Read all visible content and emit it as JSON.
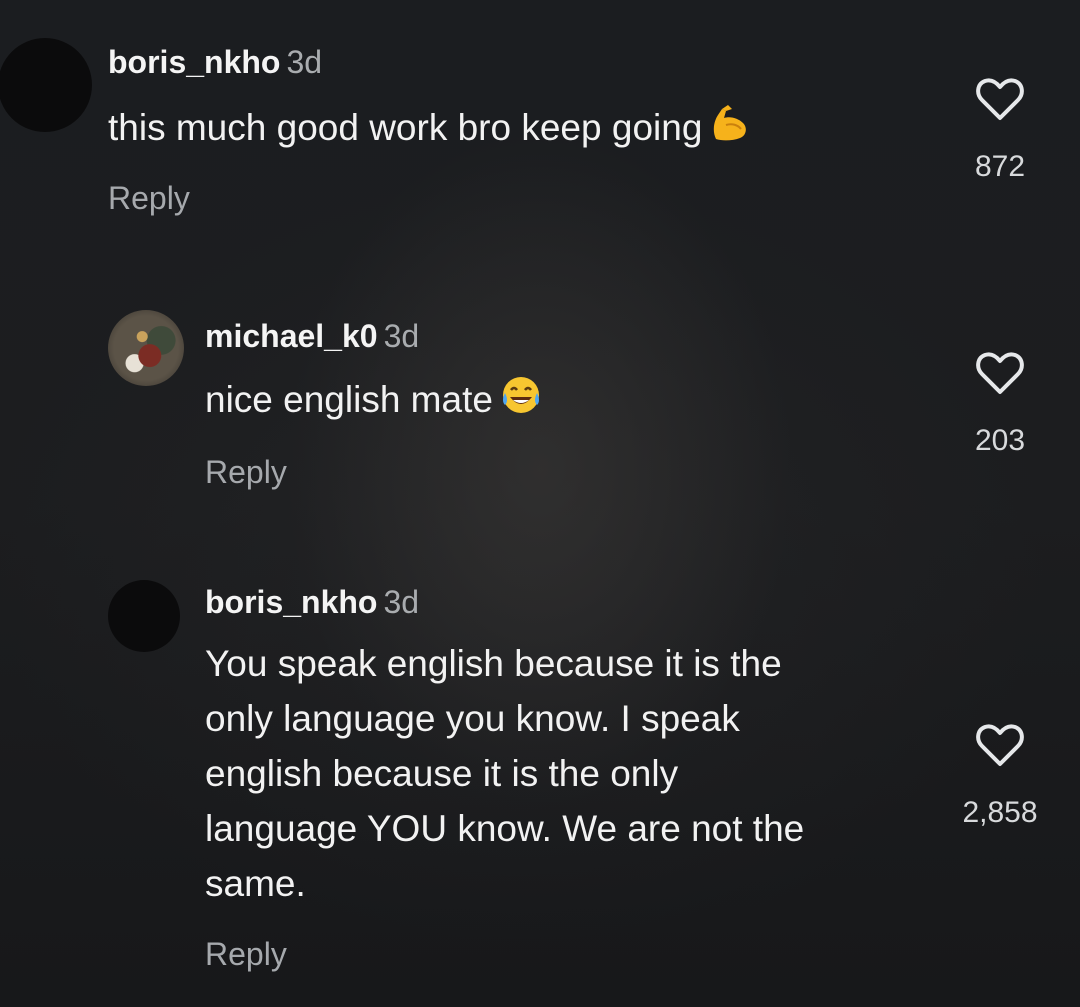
{
  "comments": [
    {
      "username": "boris_nkho",
      "time": "3d",
      "text": "this much good work bro keep going",
      "emoji_icon": "flexed-biceps-icon",
      "reply_label": "Reply",
      "likes": "872"
    },
    {
      "username": "michael_k0",
      "time": "3d",
      "text": "nice english mate",
      "emoji_icon": "tears-of-joy-icon",
      "reply_label": "Reply",
      "likes": "203"
    },
    {
      "username": "boris_nkho",
      "time": "3d",
      "text_lines": [
        "You speak english because it is the",
        "only language you know. I speak",
        "english because it is the only",
        "language YOU know. We are not the",
        "same."
      ],
      "reply_label": "Reply",
      "likes": "2,858"
    }
  ]
}
